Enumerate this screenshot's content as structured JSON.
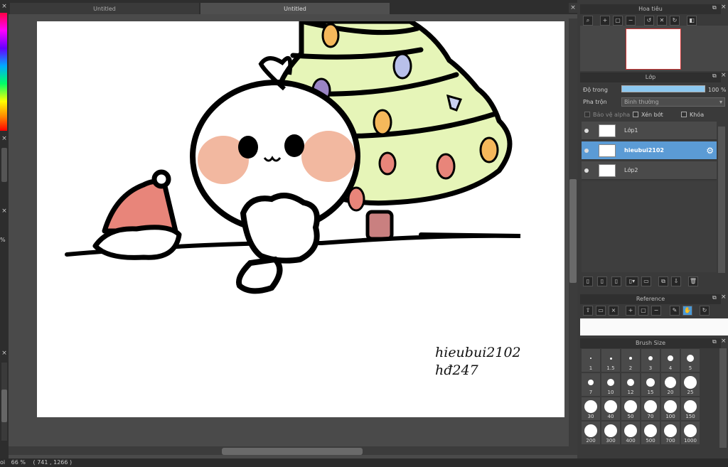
{
  "tabs": [
    {
      "label": "Untitled"
    },
    {
      "label": "Untitled"
    }
  ],
  "left": {
    "percent": "%"
  },
  "status": {
    "prefix": "oi",
    "zoom": "66 %",
    "coords": "( 741 , 1266 )"
  },
  "navigator": {
    "title": "Hoa tiêu"
  },
  "layers": {
    "title": "Lớp",
    "opacity_label": "Độ trong",
    "opacity_value": "100 %",
    "opacity": 1.0,
    "blend_label": "Pha trộn",
    "blend_value": "Bình thường",
    "protect_alpha": "Bảo vệ alpha",
    "clipping": "Xén bớt",
    "lock": "Khóa",
    "items": [
      {
        "name": "Lớp1"
      },
      {
        "name": "hieubui2102"
      },
      {
        "name": "Lớp2"
      }
    ]
  },
  "reference": {
    "title": "Reference"
  },
  "brush_size": {
    "title": "Brush Size",
    "sizes": [
      "1",
      "1.5",
      "2",
      "3",
      "4",
      "5",
      "7",
      "10",
      "12",
      "15",
      "20",
      "25",
      "30",
      "40",
      "50",
      "70",
      "100",
      "150",
      "200",
      "300",
      "400",
      "500",
      "700",
      "1000"
    ]
  },
  "artwork": {
    "signature_line1": "hieubui2102",
    "signature_line2": "hđ247"
  },
  "colors": {
    "accent": "#4a9ad8",
    "selected_layer": "#5b9bd5",
    "tree": "#e6f5b8",
    "blush": "#f2b8a0",
    "hat": "#e8857a"
  }
}
